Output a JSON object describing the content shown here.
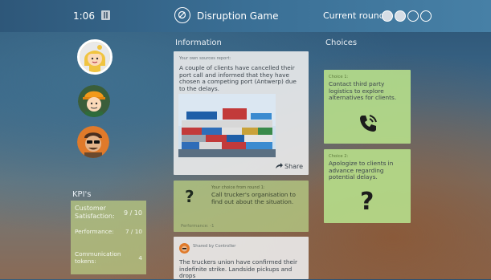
{
  "header": {
    "timer": "1:06",
    "game_title": "Disruption Game",
    "round_label": "Current round:",
    "rounds": [
      {
        "state": "done"
      },
      {
        "state": "done"
      },
      {
        "state": "open"
      },
      {
        "state": "open"
      }
    ]
  },
  "players": [
    {
      "name": "player-blonde",
      "active": true
    },
    {
      "name": "player-worker",
      "active": false
    },
    {
      "name": "player-sunglasses",
      "active": false
    }
  ],
  "kpi": {
    "title": "KPI's",
    "rows": [
      {
        "label": "Customer Satisfaction:",
        "value": "9 / 10"
      },
      {
        "label": "Performance:",
        "value": "7 / 10"
      },
      {
        "label": "Communication tokens:",
        "value": "4"
      }
    ]
  },
  "information": {
    "title": "Information",
    "report": {
      "source": "Your own sources report:",
      "text": "A couple of clients have cancelled their port call and informed that they have chosen a competing port (Antwerp) due to the delays.",
      "share_label": "Share"
    },
    "choice_card": {
      "header": "Your choice from round 1:",
      "text": "Call trucker's organisation to find out about the situation.",
      "footer": "Performance: -1"
    },
    "shared": {
      "header": "Shared by Controller",
      "text": "The truckers union have confirmed their indefinite strike. Landside pickups and drops"
    }
  },
  "choices": {
    "title": "Choices",
    "items": [
      {
        "label": "Choice 1:",
        "text": "Contact third party logistics to explore alternatives for clients.",
        "icon": "phone-icon"
      },
      {
        "label": "Choice 2:",
        "text": "Apologize to clients in advance regarding potential delays.",
        "icon": "question-icon"
      }
    ]
  },
  "colors": {
    "choice_card": "#b5dc8a",
    "kpi_card": "#b6c682",
    "header": "#3a6f95"
  }
}
